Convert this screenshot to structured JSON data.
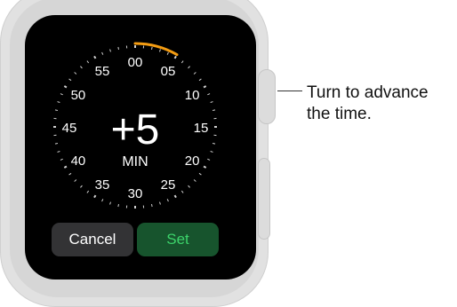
{
  "timer": {
    "value": "+5",
    "unit": "MIN",
    "progress_minutes": 5,
    "accent_color": "#f39c12"
  },
  "dial": {
    "labels": [
      "00",
      "05",
      "10",
      "15",
      "20",
      "25",
      "30",
      "35",
      "40",
      "45",
      "50",
      "55"
    ]
  },
  "buttons": {
    "cancel_label": "Cancel",
    "set_label": "Set"
  },
  "callout": {
    "line1": "Turn to advance",
    "line2": "the time."
  },
  "colors": {
    "screen": "#000000",
    "cancel_bg": "#333335",
    "set_bg": "#17542d",
    "set_text": "#3cd36a"
  }
}
